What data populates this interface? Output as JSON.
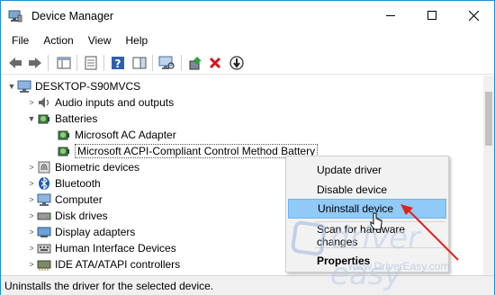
{
  "window": {
    "title": "Device Manager",
    "controls": {
      "minimize": "minimize",
      "maximize": "maximize",
      "close": "close"
    }
  },
  "menu": [
    "File",
    "Action",
    "View",
    "Help"
  ],
  "toolbar": {
    "icons": [
      "back-arrow-icon",
      "forward-arrow-icon",
      "show-hide-console-tree-icon",
      "properties-icon",
      "help-icon",
      "scan-hardware-icon",
      "update-driver-icon",
      "uninstall-x-icon",
      "disable-device-icon"
    ]
  },
  "tree": {
    "root": "DESKTOP-S90MVCS",
    "items": [
      {
        "label": "Audio inputs and outputs",
        "expanded": false,
        "icon": "speaker-icon"
      },
      {
        "label": "Batteries",
        "expanded": true,
        "icon": "battery-icon"
      },
      {
        "label": "Microsoft AC Adapter",
        "child": true,
        "icon": "battery-device-icon"
      },
      {
        "label": "Microsoft ACPI-Compliant Control Method Battery",
        "child": true,
        "selected": true,
        "icon": "battery-device-icon"
      },
      {
        "label": "Biometric devices",
        "expanded": false,
        "icon": "fingerprint-icon"
      },
      {
        "label": "Bluetooth",
        "expanded": false,
        "icon": "bluetooth-icon"
      },
      {
        "label": "Computer",
        "expanded": false,
        "icon": "computer-icon"
      },
      {
        "label": "Disk drives",
        "expanded": false,
        "icon": "disk-drive-icon"
      },
      {
        "label": "Display adapters",
        "expanded": false,
        "icon": "display-adapter-icon"
      },
      {
        "label": "Human Interface Devices",
        "expanded": false,
        "icon": "hid-icon"
      },
      {
        "label": "IDE ATA/ATAPI controllers",
        "expanded": false,
        "icon": "ide-controller-icon"
      }
    ]
  },
  "context_menu": {
    "items": [
      "Update driver",
      "Disable device",
      "Uninstall device",
      "Scan for hardware changes",
      "Properties"
    ],
    "highlighted": "Uninstall device"
  },
  "status": "Uninstalls the driver for the selected device.",
  "watermark": {
    "brand": "driver easy",
    "url": "www.DriverEasy.com"
  },
  "colors": {
    "accent": "#1a8fd8",
    "menu_highlight": "#91c9f7",
    "arrow": "#e0201a"
  }
}
